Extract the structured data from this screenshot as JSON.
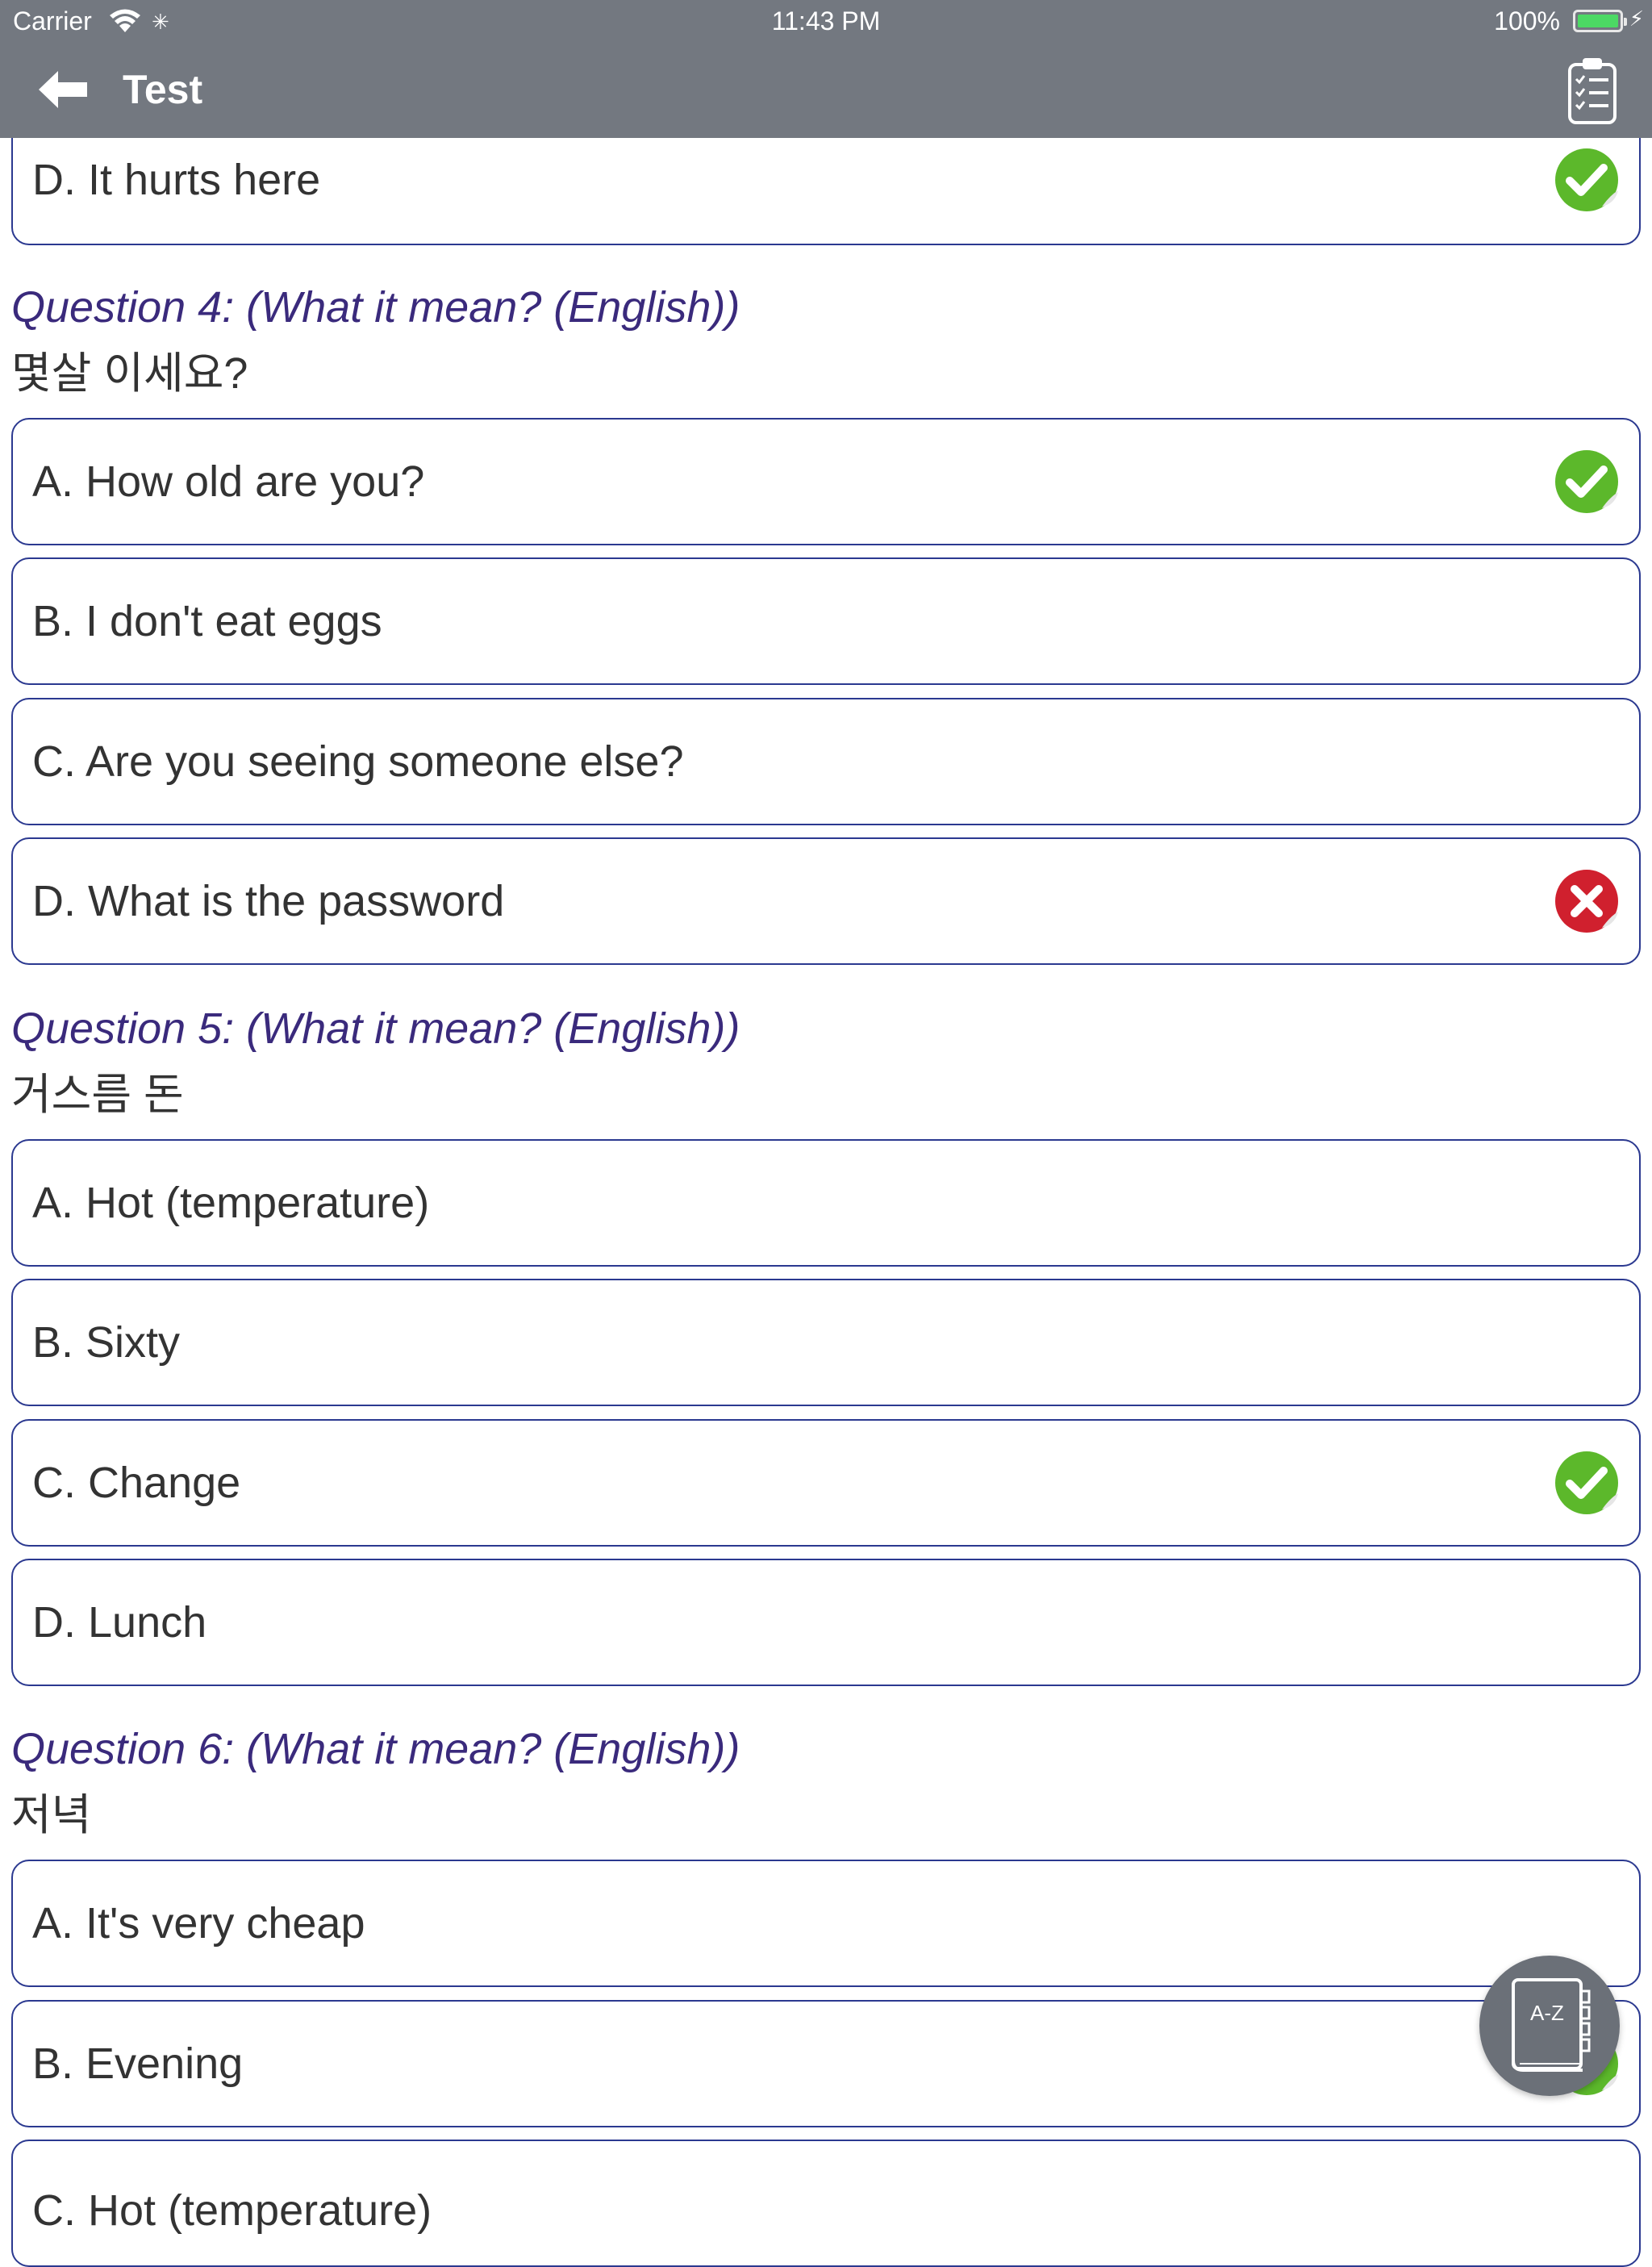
{
  "status_bar": {
    "carrier": "Carrier",
    "time": "11:43 PM",
    "battery": "100%"
  },
  "nav": {
    "title": "Test"
  },
  "question3": {
    "options": [
      {
        "label": "D. It hurts here",
        "mark": "correct"
      }
    ]
  },
  "question4": {
    "title": "Question 4: (What it mean? (English))",
    "korean": "몇살 이세요?",
    "options": [
      {
        "label": "A. How old are you?",
        "mark": "correct"
      },
      {
        "label": "B. I don't eat eggs",
        "mark": "none"
      },
      {
        "label": "C. Are you seeing someone else?",
        "mark": "none"
      },
      {
        "label": "D. What is the password",
        "mark": "wrong"
      }
    ]
  },
  "question5": {
    "title": "Question 5: (What it mean? (English))",
    "korean": "거스름 돈",
    "options": [
      {
        "label": "A. Hot (temperature)",
        "mark": "none"
      },
      {
        "label": "B. Sixty",
        "mark": "none"
      },
      {
        "label": "C. Change",
        "mark": "correct"
      },
      {
        "label": "D. Lunch",
        "mark": "none"
      }
    ]
  },
  "question6": {
    "title": "Question 6: (What it mean? (English))",
    "korean": "저녁",
    "options": [
      {
        "label": "A. It's very cheap",
        "mark": "none"
      },
      {
        "label": "B. Evening",
        "mark": "correct"
      },
      {
        "label": "C. Hot (temperature)",
        "mark": "none"
      }
    ]
  },
  "dictionary_button": {
    "label": "A-Z"
  },
  "colors": {
    "correct": "#5cb82b",
    "wrong": "#d0202e",
    "card_border": "#2b3990",
    "question_title": "#3a2a7c",
    "header": "#737880"
  }
}
